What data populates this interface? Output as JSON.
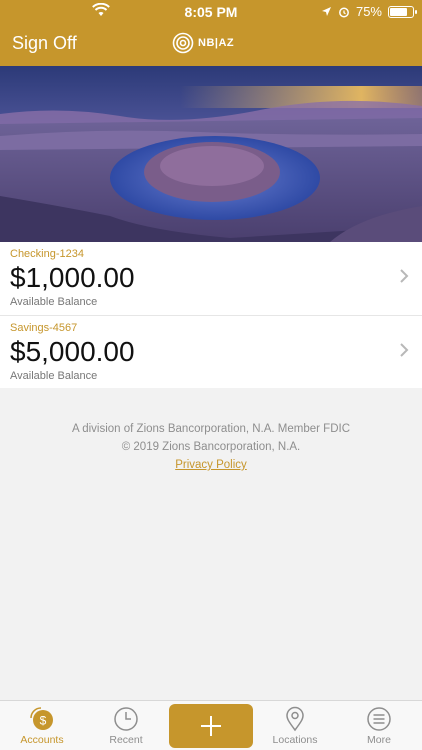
{
  "status": {
    "time": "8:05 PM",
    "battery": "75%"
  },
  "nav": {
    "sign_off": "Sign Off",
    "logo_text": "NB|AZ"
  },
  "accounts": [
    {
      "name": "Checking-1234",
      "balance": "$1,000.00",
      "label": "Available Balance"
    },
    {
      "name": "Savings-4567",
      "balance": "$5,000.00",
      "label": "Available Balance"
    }
  ],
  "footer": {
    "line1": "A division of Zions Bancorporation, N.A. Member FDIC",
    "line2": "© 2019 Zions Bancorporation, N.A.",
    "privacy": "Privacy Policy"
  },
  "tabs": {
    "accounts": "Accounts",
    "recent": "Recent",
    "locations": "Locations",
    "more": "More"
  },
  "colors": {
    "brand": "#c6962c",
    "inactive": "#8e8e8e"
  }
}
